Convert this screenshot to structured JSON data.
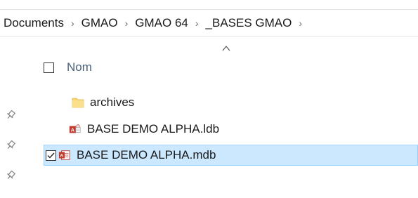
{
  "breadcrumb": {
    "items": [
      "Documents",
      "GMAO",
      "GMAO 64",
      "_BASES GMAO"
    ],
    "separator": "›"
  },
  "header": {
    "column_name": "Nom",
    "sort_indicator": "ascending"
  },
  "files": [
    {
      "name": "archives",
      "icon": "folder-icon",
      "selected": false
    },
    {
      "name": "BASE DEMO ALPHA.ldb",
      "icon": "access-lock-file-icon",
      "selected": false
    },
    {
      "name": "BASE DEMO ALPHA.mdb",
      "icon": "access-database-icon",
      "selected": true,
      "checked": true
    }
  ],
  "quick_access_pins": [
    "pin-icon",
    "pin-icon",
    "pin-icon"
  ],
  "colors": {
    "selection_bg": "#cce8ff",
    "selection_border": "#99d1ff",
    "header_text": "#4c607a",
    "folder": "#f8d775",
    "access_red": "#c0392b"
  }
}
